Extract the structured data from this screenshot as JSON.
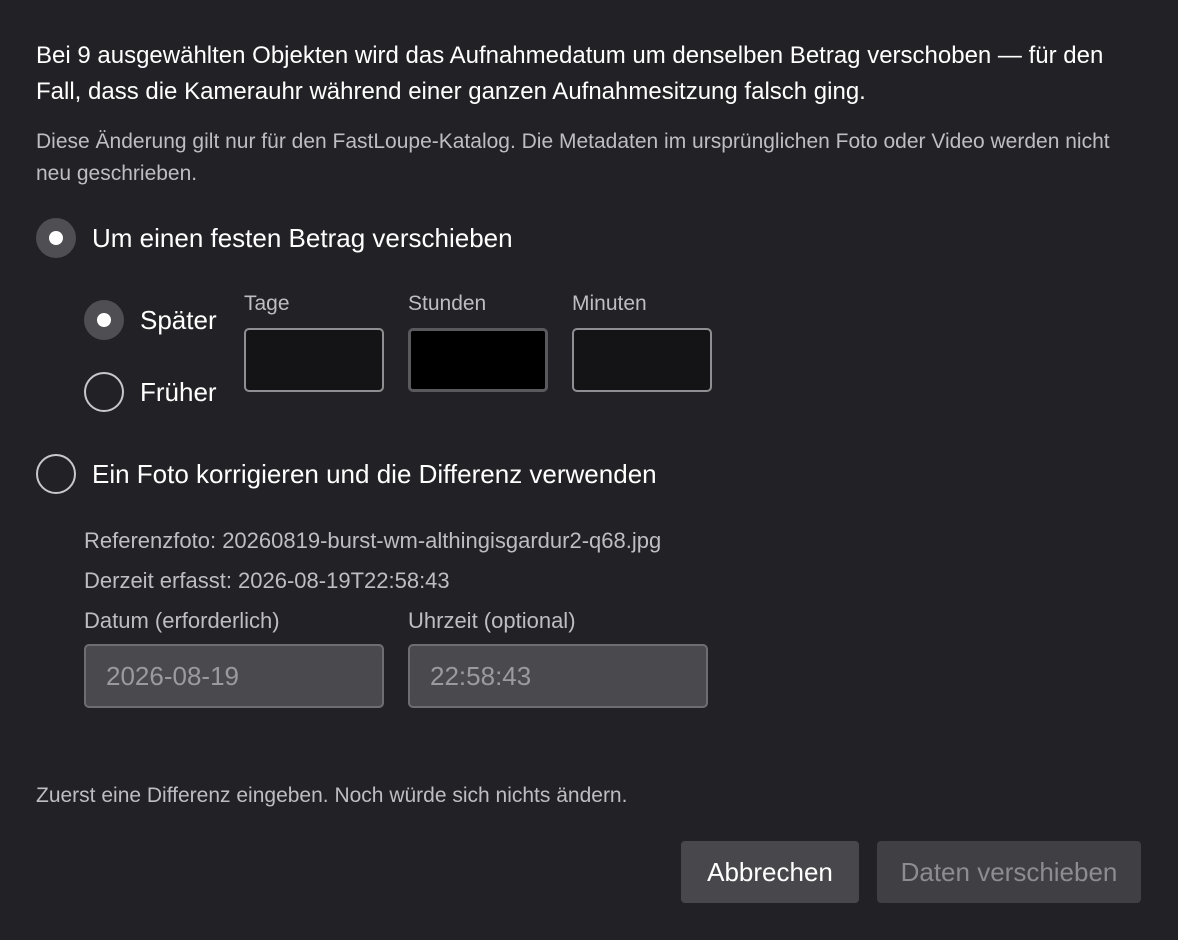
{
  "intro_text": "Bei 9 ausgewählten Objekten wird das Aufnahmedatum um denselben Betrag verschoben — für den Fall, dass die Kamerauhr während einer ganzen Aufnahmesitzung falsch ging.",
  "note_text": "Diese Änderung gilt nur für den FastLoupe-Katalog. Die Metadaten im ursprünglichen Foto oder Video werden nicht neu geschrieben.",
  "mode_fixed": {
    "label": "Um einen festen Betrag verschieben",
    "selected": true
  },
  "direction": {
    "later_label": "Später",
    "earlier_label": "Früher",
    "selected": "later"
  },
  "offset_fields": {
    "days_label": "Tage",
    "days_value": "",
    "hours_label": "Stunden",
    "hours_value": "",
    "minutes_label": "Minuten",
    "minutes_value": ""
  },
  "mode_photo": {
    "label": "Ein Foto korrigieren und die Differenz verwenden",
    "selected": false
  },
  "reference": {
    "photo_line": "Referenzfoto: 20260819-burst-wm-althingisgardur2-q68.jpg",
    "captured_line": "Derzeit erfasst: 2026-08-19T22:58:43",
    "date_label": "Datum (erforderlich)",
    "date_value": "2026-08-19",
    "time_label": "Uhrzeit (optional)",
    "time_value": "22:58:43"
  },
  "status_text": "Zuerst eine Differenz eingeben. Noch würde sich nichts ändern.",
  "buttons": {
    "cancel_label": "Abbrechen",
    "shift_label": "Daten verschieben"
  }
}
